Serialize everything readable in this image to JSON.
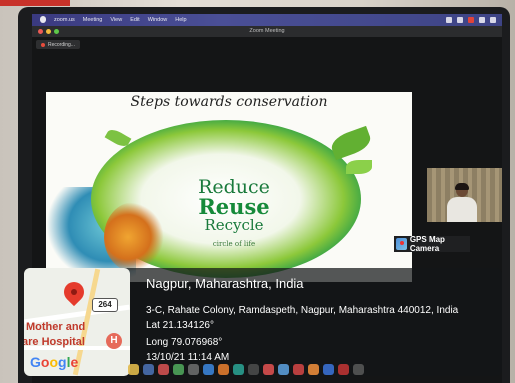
{
  "menubar": {
    "items": [
      "zoom.us",
      "Meeting",
      "View",
      "Edit",
      "Window",
      "Help"
    ]
  },
  "window": {
    "title": "Zoom Meeting",
    "recording_label": "Recording..."
  },
  "slide": {
    "title": "Steps towards conservation",
    "line1": "Reduce",
    "line2": "Reuse",
    "line3": "Recycle",
    "tagline": "circle of life"
  },
  "participant_panel": {
    "app_label": "GPS Map Camera"
  },
  "gps_overlay": {
    "location": "Nagpur, Maharashtra, India",
    "address": "3-C, Rahate Colony, Ramdaspeth, Nagpur, Maharashtra 440012, India",
    "latitude": "Lat 21.134126°",
    "longitude": "Long 79.076968°",
    "timestamp": "13/10/21 11:14 AM"
  },
  "map": {
    "road_shield": "264",
    "label_line1": "Mother and",
    "label_line2": "are Hospital",
    "hospital_glyph": "H",
    "logo": [
      "G",
      "o",
      "o",
      "g",
      "l",
      "e"
    ]
  },
  "colors": {
    "menubar": "#3e4486",
    "slide_green": "#168a3a",
    "pin_red": "#e53b2c"
  },
  "icons": [
    "apple-icon",
    "map-pin-icon",
    "hospital-icon",
    "gps-camera-icon"
  ]
}
